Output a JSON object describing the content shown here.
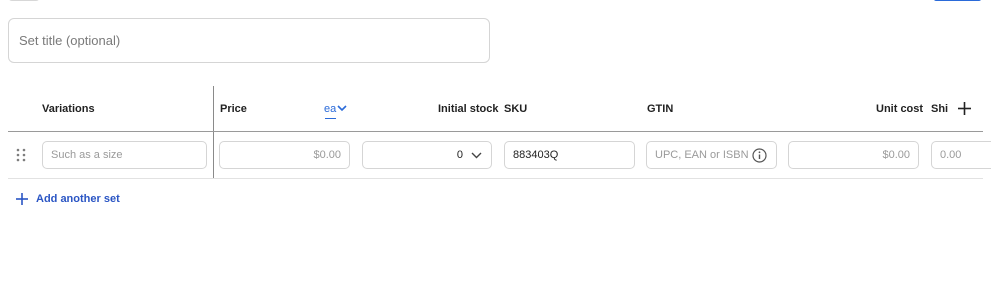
{
  "title_field": {
    "placeholder": "Set title (optional)"
  },
  "table": {
    "headers": {
      "variations": "Variations",
      "price": "Price",
      "unit_selector": "ea",
      "initial_stock": "Initial stock",
      "sku": "SKU",
      "gtin": "GTIN",
      "unit_cost": "Unit cost",
      "shipping_truncated": "Shi"
    },
    "row": {
      "size_placeholder": "Such as a size",
      "price_placeholder": "$0.00",
      "initial_stock_value": "0",
      "sku_value": "883403Q",
      "gtin_placeholder": "UPC, EAN or ISBN",
      "unit_cost_placeholder": "$0.00",
      "shipping_placeholder": "0.00"
    }
  },
  "add_set": {
    "label": "Add another set"
  },
  "icons": {
    "chevron": "chevron-down-icon",
    "add_column": "plus-icon",
    "drag": "drag-handle-icon",
    "info": "info-icon",
    "add_set": "plus-icon"
  },
  "colors": {
    "accent": "#2a6ad9",
    "link": "#2a55c4",
    "border": "#d5d5d5"
  }
}
